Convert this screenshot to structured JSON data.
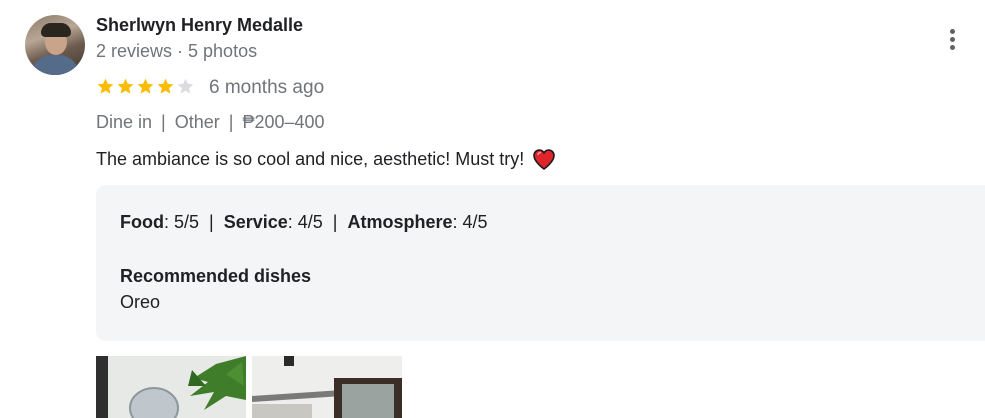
{
  "review": {
    "author": "Sherlwyn Henry Medalle",
    "meta": "2 reviews · 5 photos",
    "rating": 4,
    "max_rating": 5,
    "date": "6 months ago",
    "tags": [
      "Dine in",
      "Other",
      "₱200–400"
    ],
    "text": "The ambiance is so cool and nice, aesthetic! Must try!",
    "details": {
      "food_label": "Food",
      "food_value": ": 5/5",
      "service_label": "Service",
      "service_value": ": 4/5",
      "atmosphere_label": "Atmosphere",
      "atmosphere_value": ": 4/5",
      "recommended_title": "Recommended dishes",
      "recommended_dish": "Oreo"
    },
    "photos_count_visible": 2
  },
  "colors": {
    "star_filled": "#fbbc04",
    "star_empty": "#dadce0",
    "heart": "#e0242c",
    "panel_bg": "#f4f5f6"
  },
  "icons": {
    "more": "more-vert-icon",
    "heart": "heart-emoji-icon",
    "star": "star-icon"
  }
}
